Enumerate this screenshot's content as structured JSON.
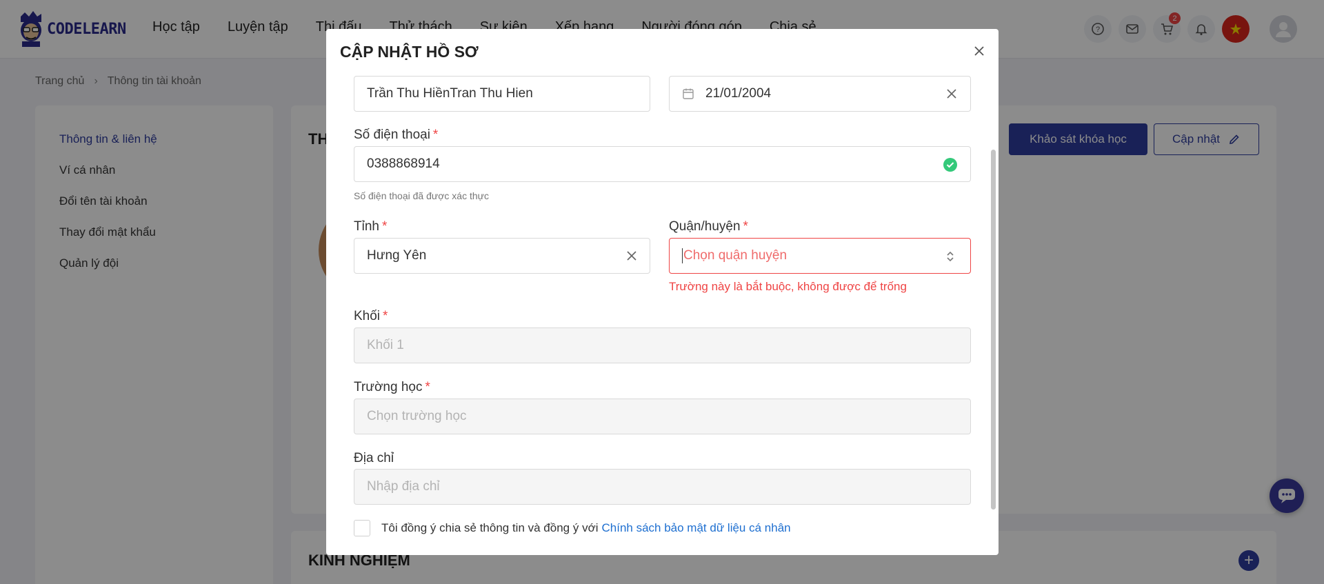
{
  "app": {
    "logo_text": "CODELEARN",
    "nav": [
      "Học tập",
      "Luyện tập",
      "Thi đấu",
      "Thử thách",
      "Sự kiện",
      "Xếp hạng",
      "Người đóng góp",
      "Chia sẻ"
    ],
    "cart_count": "2",
    "icons": [
      "help-icon",
      "mail-icon",
      "cart-icon",
      "bell-icon",
      "flag-icon",
      "avatar-icon"
    ]
  },
  "breadcrumb": {
    "home": "Trang chủ",
    "current": "Thông tin tài khoản"
  },
  "sidebar": {
    "items": [
      "Thông tin & liên hệ",
      "Ví cá nhân",
      "Đổi tên tài khoản",
      "Thay đổi mật khẩu",
      "Quản lý đội"
    ]
  },
  "main": {
    "title": "TH",
    "survey_button": "Khảo sát khóa học",
    "update_button": "Cập nhật"
  },
  "experience": {
    "title": "KINH NGHIỆM"
  },
  "modal": {
    "title": "CẬP NHẬT HỒ SƠ",
    "name_value": "Trần Thu HiềnTran Thu Hien",
    "dob_value": "21/01/2004",
    "phone": {
      "label": "Số điện thoại",
      "value": "0388868914",
      "hint": "Số điện thoại đã được xác thực"
    },
    "province": {
      "label": "Tỉnh",
      "value": "Hưng Yên"
    },
    "district": {
      "label": "Quận/huyện",
      "placeholder": "Chọn quận huyện",
      "error": "Trường này là bắt buộc, không được để trống"
    },
    "grade": {
      "label": "Khối",
      "placeholder": "Khối 1"
    },
    "school": {
      "label": "Trường học",
      "placeholder": "Chọn trường học"
    },
    "address": {
      "label": "Địa chỉ",
      "placeholder": "Nhập địa chỉ"
    },
    "consent": {
      "text": "Tôi đồng ý chia sẻ thông tin và đồng ý với",
      "link": "Chính sách bảo mật dữ liệu cá nhân"
    }
  },
  "colors": {
    "brand": "#2f3c9e",
    "error": "#ef4444",
    "success": "#34c97a",
    "link": "#1e6fd0"
  }
}
